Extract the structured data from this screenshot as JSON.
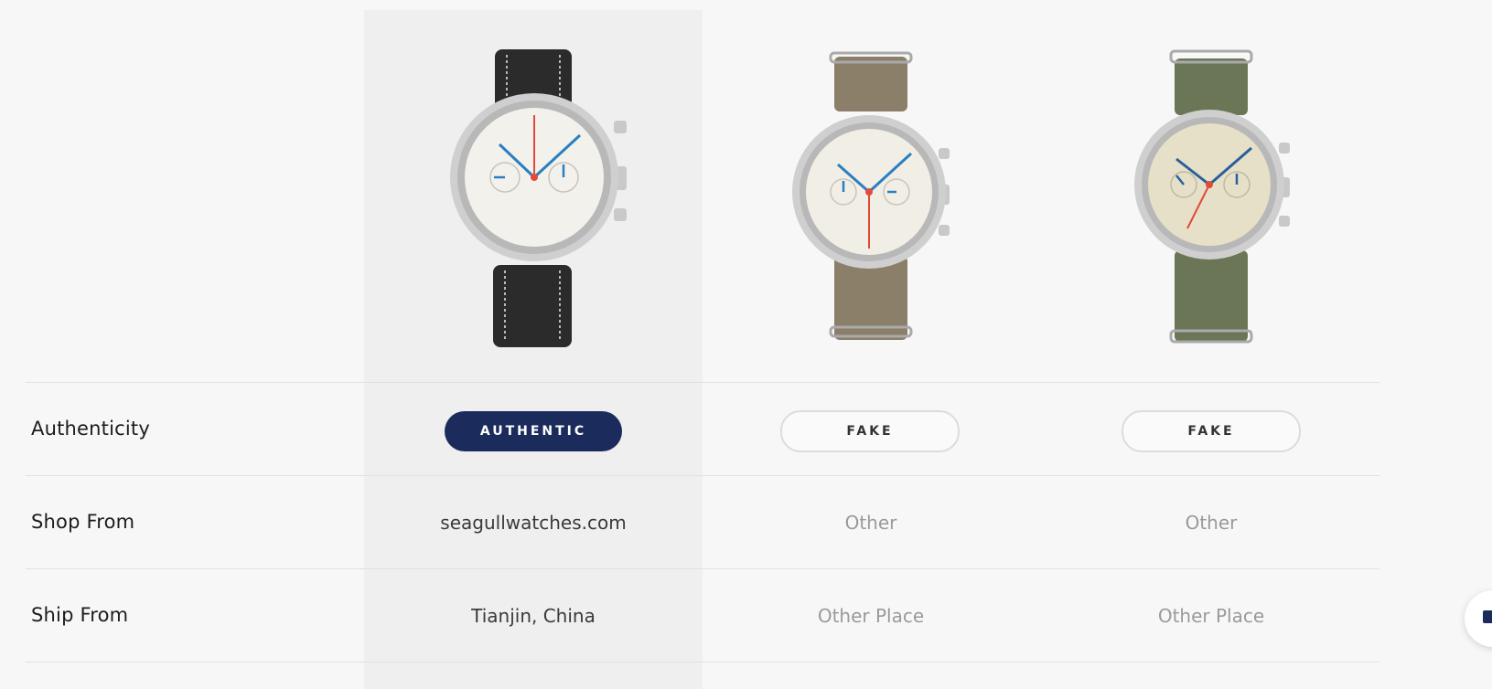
{
  "columns": [
    {
      "authenticity": "AUTHENTIC",
      "shop_from": "seagullwatches.com",
      "ship_from": "Tianjin, China",
      "watch_image": "black-leather-strap-chronograph-watch"
    },
    {
      "authenticity": "FAKE",
      "shop_from": "Other",
      "ship_from": "Other Place",
      "watch_image": "khaki-nato-strap-chronograph-watch"
    },
    {
      "authenticity": "FAKE",
      "shop_from": "Other",
      "ship_from": "Other Place",
      "watch_image": "green-nato-strap-chronograph-watch"
    }
  ],
  "rows": {
    "authenticity": "Authenticity",
    "shop_from": "Shop From",
    "ship_from": "Ship From"
  },
  "colors": {
    "authentic_badge": "#1b2c5c",
    "highlight_column": "#efefef",
    "muted_text": "#9a9a9a"
  },
  "chat_widget": {
    "icon": "chat-bubble-icon"
  }
}
